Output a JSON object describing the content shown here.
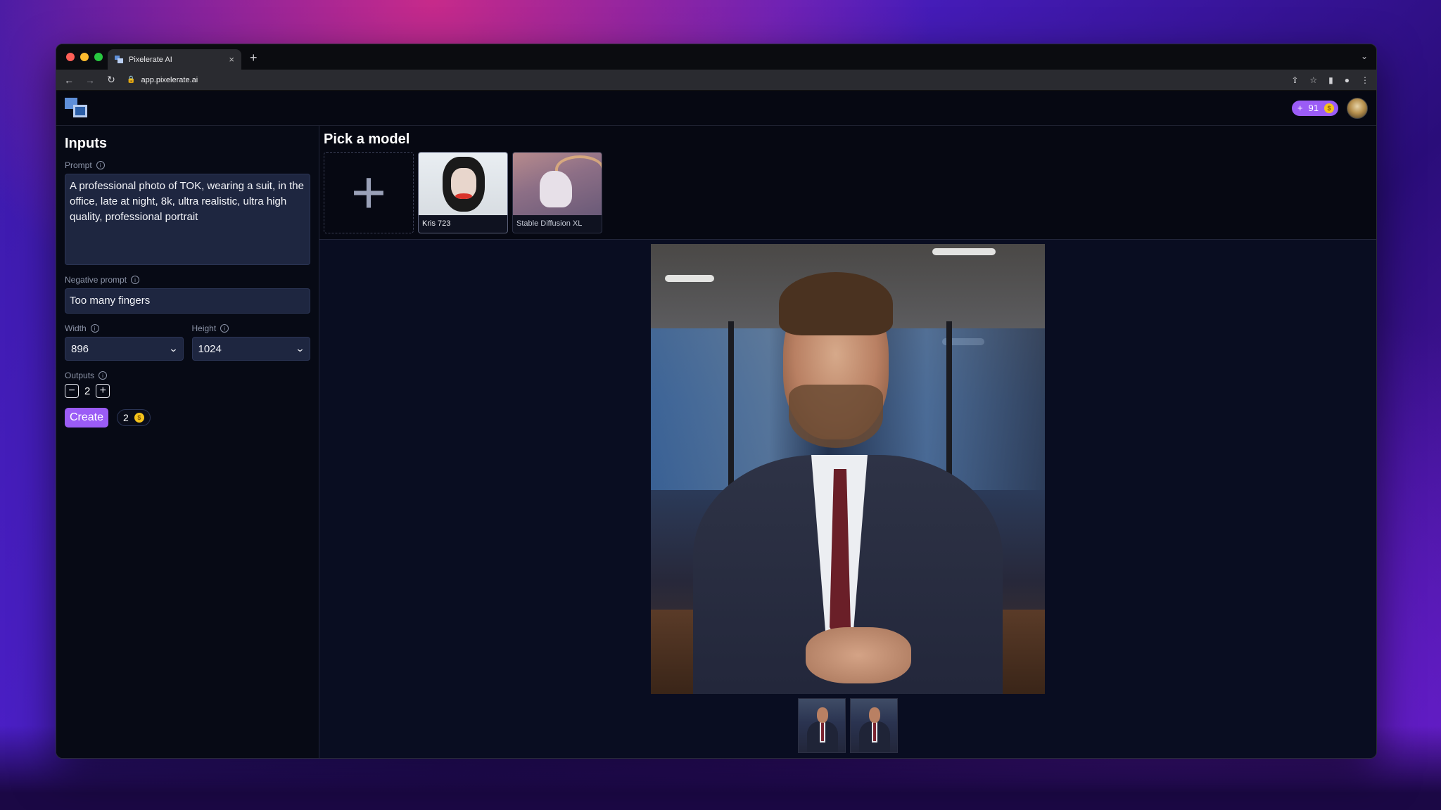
{
  "browser": {
    "tab_title": "Pixelerate AI",
    "tab_close": "×",
    "new_tab": "+",
    "tab_menu": "⌄",
    "url": "app.pixelerate.ai",
    "back": "←",
    "forward": "→",
    "reload": "↻"
  },
  "header": {
    "credits_plus": "+",
    "credits_value": "91",
    "coin_symbol": "$"
  },
  "inputs": {
    "title": "Inputs",
    "prompt_label": "Prompt",
    "prompt_value": "A professional photo of TOK, wearing a suit, in the office, late at night, 8k, ultra realistic, ultra high quality, professional portrait",
    "negative_label": "Negative prompt",
    "negative_value": "Too many fingers",
    "width_label": "Width",
    "width_value": "896",
    "height_label": "Height",
    "height_value": "1024",
    "outputs_label": "Outputs",
    "outputs_value": "2",
    "minus": "−",
    "plus": "+",
    "create_label": "Create",
    "cost_value": "2",
    "info": "i"
  },
  "models": {
    "title": "Pick a model",
    "add_symbol": "+",
    "cards": [
      {
        "name": "Kris 723",
        "selected": true
      },
      {
        "name": "Stable Diffusion XL",
        "selected": false
      }
    ]
  },
  "icons": {
    "logo": "pixelerate-logo",
    "info": "info-icon",
    "chevron": "chevron-down-icon",
    "coin": "coin-icon"
  },
  "colors": {
    "accent": "#9b5cf6",
    "coin": "#f5c31b",
    "panel": "#1e2640"
  }
}
